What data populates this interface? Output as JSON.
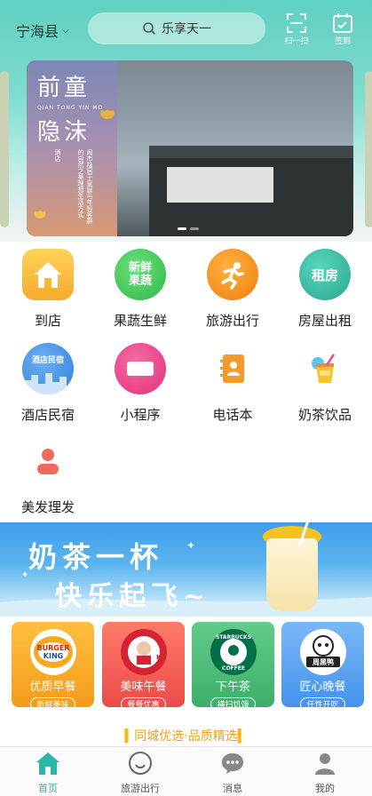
{
  "header": {
    "city": "宁海县",
    "search_query": "乐享天一",
    "scan_label": "扫一扫",
    "checkin_label": "签到",
    "colors": {
      "accent": "#5fd0c2"
    }
  },
  "banner": {
    "title_line1": "前童",
    "pinyin": "QIAN TONG YIN MO",
    "title_line2": "隐沫",
    "side_text_1": "酒店",
    "side_text_2": "闹市隐居于家庭与年轻客群的自然之美理想生活方式"
  },
  "categories": [
    {
      "label": "到店",
      "icon": "house-icon",
      "color": "#f7b733"
    },
    {
      "label": "果蔬生鲜",
      "icon": "fresh-produce-icon",
      "color": "#3ec653",
      "badge": "新鲜果蔬"
    },
    {
      "label": "旅游出行",
      "icon": "runner-icon",
      "color": "#f59b1b"
    },
    {
      "label": "房屋出租",
      "icon": "rent-icon",
      "color": "#38b9a3",
      "badge": "租房"
    },
    {
      "label": "酒店民宿",
      "icon": "hotel-icon",
      "color": "#4a94e8",
      "badge": "酒店民宿"
    },
    {
      "label": "小程序",
      "icon": "mini-program-icon",
      "color": "#ea4b8c"
    },
    {
      "label": "电话本",
      "icon": "phonebook-icon",
      "color": "#f39a2a"
    },
    {
      "label": "奶茶饮品",
      "icon": "drink-icon",
      "color": "#f3b82a"
    },
    {
      "label": "美发理发",
      "icon": "person-icon",
      "color": "#f06a5a"
    }
  ],
  "milk_tea_banner": {
    "line1": "奶茶一杯",
    "line2": "快乐起飞~"
  },
  "food_cards": [
    {
      "brand": "BURGER KING",
      "title": "优质早餐",
      "tag": "新鲜美味",
      "bg": "#f6a51f"
    },
    {
      "brand": "KFC",
      "title": "美味午餐",
      "tag": "餐餐优惠",
      "bg": "#f2645a"
    },
    {
      "brand": "STARBUCKS COFFEE",
      "title": "下午茶",
      "tag": "横扫饥饿",
      "bg": "#4fbf7a"
    },
    {
      "brand": "周黑鸭",
      "title": "匠心晚餐",
      "tag": "任性开吃",
      "bg": "#5aa2f0"
    }
  ],
  "slogan": "同城优选·品质精选",
  "nav": [
    {
      "label": "首页",
      "icon": "home-icon",
      "active": true
    },
    {
      "label": "旅游出行",
      "icon": "smile-icon",
      "active": false
    },
    {
      "label": "消息",
      "icon": "chat-icon",
      "active": false
    },
    {
      "label": "我的",
      "icon": "user-icon",
      "active": false
    }
  ]
}
